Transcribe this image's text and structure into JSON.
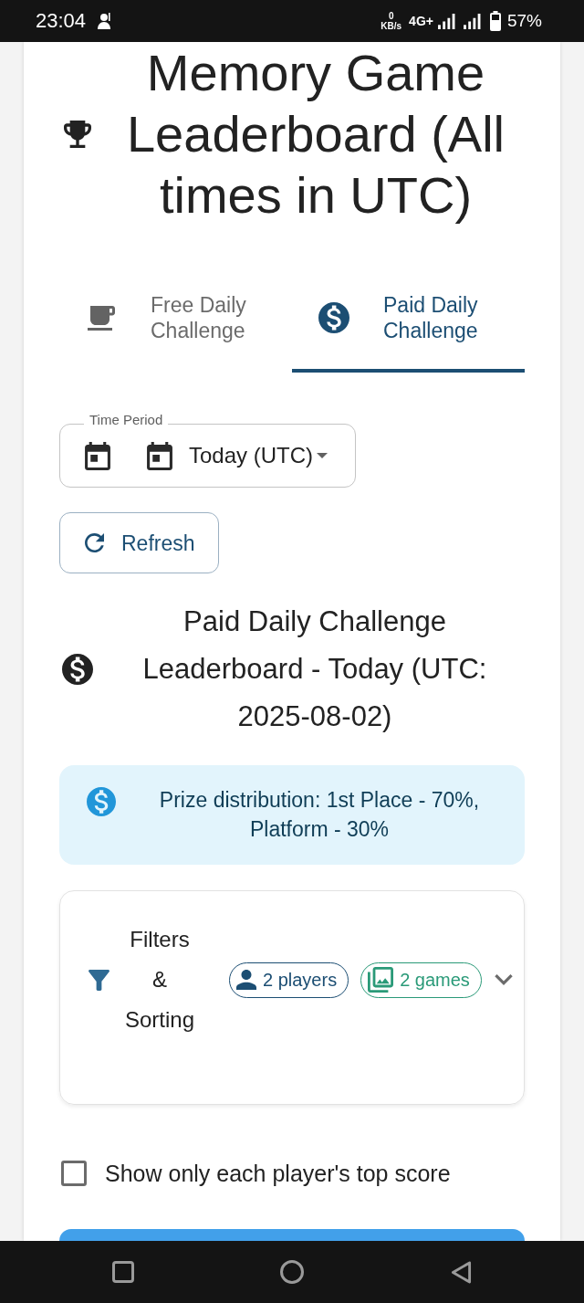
{
  "status_bar": {
    "time": "23:04",
    "net_speed_value": "0",
    "net_speed_unit": "KB/s",
    "network": "4G+",
    "battery": "57%"
  },
  "title": "Memory Game Leaderboard (All times in UTC)",
  "tabs": [
    {
      "label": "Free Daily Challenge",
      "kind": "cup",
      "selected": false
    },
    {
      "label": "Paid Daily Challenge",
      "kind": "dollar",
      "selected": true
    }
  ],
  "time_period": {
    "label": "Time Period",
    "value": "Today (UTC)"
  },
  "refresh_button": "Refresh",
  "heading": "Paid Daily Challenge Leaderboard - Today (UTC: 2025-08-02)",
  "info": "Prize distribution: 1st Place - 70%, Platform - 30%",
  "filters": {
    "title": "Filters & Sorting",
    "expanded": false,
    "chips": [
      {
        "label": "2 players",
        "kind": "person",
        "color": "#1c4e73"
      },
      {
        "label": "2 games",
        "kind": "images",
        "color": "#2a9a78"
      }
    ]
  },
  "top_score_only": {
    "label": "Show only each player's top score",
    "checked": false
  }
}
